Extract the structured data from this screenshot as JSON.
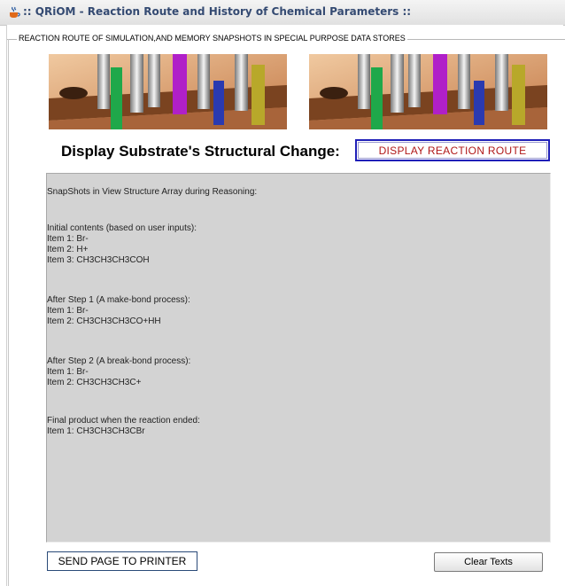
{
  "window": {
    "title": ":: QRiOM - Reaction Route and History of Chemical Parameters ::",
    "icon": "java-cup-icon"
  },
  "panel": {
    "group_title": "REACTION ROUTE OF SIMULATION,AND MEMORY SNAPSHOTS IN SPECIAL PURPOSE DATA STORES"
  },
  "images": {
    "left": "test-tube-rack-image",
    "right": "test-tube-rack-image"
  },
  "display": {
    "heading": "Display Substrate's Structural Change:",
    "route_button": "DISPLAY REACTION ROUTE"
  },
  "snapshot": {
    "header": "SnapShots in View Structure Array during Reasoning:",
    "sections": [
      {
        "title": "Initial contents (based on user inputs):",
        "items": [
          "Item 1:  Br-",
          "Item 2:  H+",
          "Item 3:  CH3CH3CH3COH"
        ]
      },
      {
        "title": "After Step 1 (A make-bond process):",
        "items": [
          "Item 1:  Br-",
          "Item 2:  CH3CH3CH3CO+HH"
        ]
      },
      {
        "title": "After Step 2 (A break-bond process):",
        "items": [
          "Item 1:  Br-",
          "Item 2:  CH3CH3CH3C+"
        ]
      },
      {
        "title": "Final product when the reaction ended:",
        "items": [
          "Item 1:  CH3CH3CH3CBr"
        ]
      }
    ]
  },
  "buttons": {
    "print": "SEND PAGE TO PRINTER",
    "clear": "Clear Texts"
  },
  "colors": {
    "route_button_text": "#b01818",
    "route_button_border": "#1f1fb8",
    "text_area_bg": "#d3d3d3",
    "title_text": "#344a72"
  }
}
